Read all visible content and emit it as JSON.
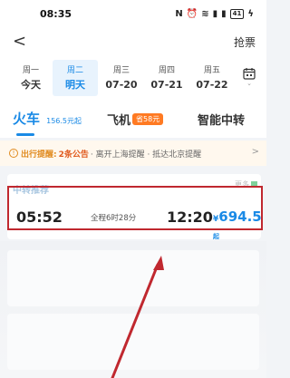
{
  "status_bar": {
    "time": "08:35",
    "battery": "41"
  },
  "nav": {
    "back_glyph": "<",
    "grab_ticket_label": "抢票"
  },
  "dates": [
    {
      "weekday": "周一",
      "date": "今天",
      "selected": false
    },
    {
      "weekday": "周二",
      "date": "明天",
      "selected": true
    },
    {
      "weekday": "周三",
      "date": "07-20",
      "selected": false
    },
    {
      "weekday": "周四",
      "date": "07-21",
      "selected": false
    },
    {
      "weekday": "周五",
      "date": "07-22",
      "selected": false
    }
  ],
  "tabs": {
    "train_label": "火车",
    "train_price": "156.5元起",
    "plane_label": "飞机",
    "plane_badge": "省58元",
    "transfer_label": "智能中转"
  },
  "notice": {
    "icon": "!",
    "label": "出行提醒:",
    "count": "2条公告",
    "text": "· 离开上海提醒 · 抵达北京提醒",
    "chevron": ">"
  },
  "transfer_card": {
    "title": "中转推荐",
    "more": "更多",
    "depart_time": "05:52",
    "duration": "全程6时28分",
    "arrive_time": "12:20",
    "currency": "¥",
    "price": "694.5",
    "price_suffix": "起"
  },
  "colors": {
    "accent": "#1a8ae6",
    "highlight": "#c0282f",
    "notice": "#e08a1e",
    "badge": "#ff7a22"
  }
}
